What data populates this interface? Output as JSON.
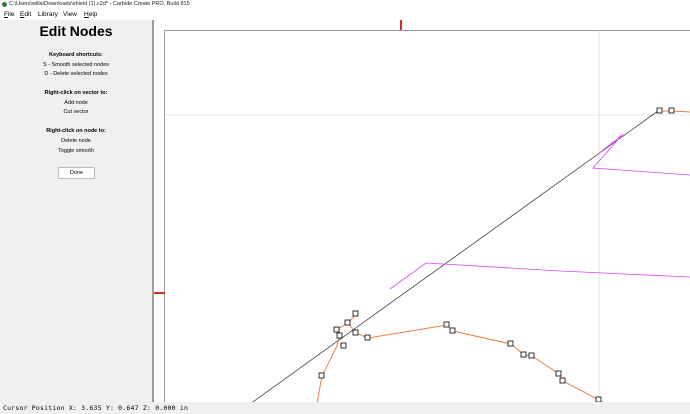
{
  "window": {
    "title": "C:\\Users\\willa\\Downloads\\shield (1).c2d* - Carbide Create PRO, Build 815"
  },
  "menu": {
    "items": [
      {
        "key": "File",
        "mnemonic": "F",
        "rest": "ile"
      },
      {
        "key": "Edit",
        "mnemonic": "E",
        "rest": "dit"
      },
      {
        "key": "Library",
        "mnemonic": "",
        "rest": "Library"
      },
      {
        "key": "View",
        "mnemonic": "",
        "rest": "View"
      },
      {
        "key": "Help",
        "mnemonic": "H",
        "rest": "elp"
      }
    ]
  },
  "panel": {
    "title": "Edit Nodes",
    "shortcuts_heading": "Keyboard shortcuts:",
    "shortcut_s": "S - Smooth selected nodes",
    "shortcut_d": "D - Delete selected nodes",
    "vector_heading": "Right-click on vector to:",
    "vector_add": "Add node",
    "vector_cut": "Cut vector",
    "node_heading": "Right-click on node to:",
    "node_delete": "Delete node",
    "node_toggle": "Toggle smooth",
    "done_label": "Done"
  },
  "status": {
    "cursor_position": "Cursor Position X: 3.635 Y: 0.647 Z: 0.000 in"
  },
  "colors": {
    "selected_path": "#f07f3c",
    "magenta_path": "#e040fb",
    "grid_line": "#444444",
    "ruler_marker": "#d32f2f"
  }
}
